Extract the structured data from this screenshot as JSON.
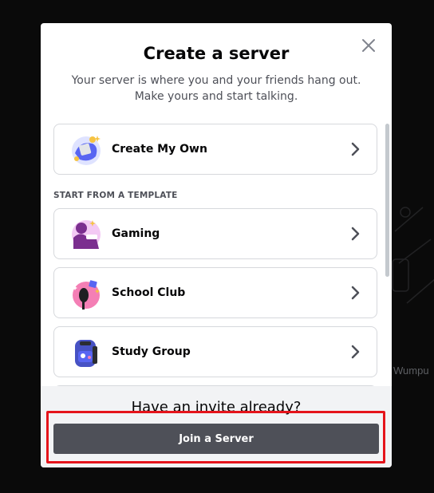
{
  "modal": {
    "title": "Create a server",
    "subtitle": "Your server is where you and your friends hang out. Make yours and start talking.",
    "close_icon": "close-icon"
  },
  "options": {
    "create_own": {
      "label": "Create My Own",
      "icon": "create-server-icon"
    },
    "section_label": "START FROM A TEMPLATE",
    "templates": [
      {
        "label": "Gaming",
        "icon": "gaming-icon"
      },
      {
        "label": "School Club",
        "icon": "school-club-icon"
      },
      {
        "label": "Study Group",
        "icon": "study-group-icon"
      }
    ]
  },
  "footer": {
    "title": "Have an invite already?",
    "join_label": "Join a Server"
  },
  "background": {
    "partial_text": "Wumpu"
  },
  "colors": {
    "modal_bg": "#ffffff",
    "footer_bg": "#f2f3f5",
    "join_button": "#4e5058",
    "highlight": "#e5141b"
  }
}
